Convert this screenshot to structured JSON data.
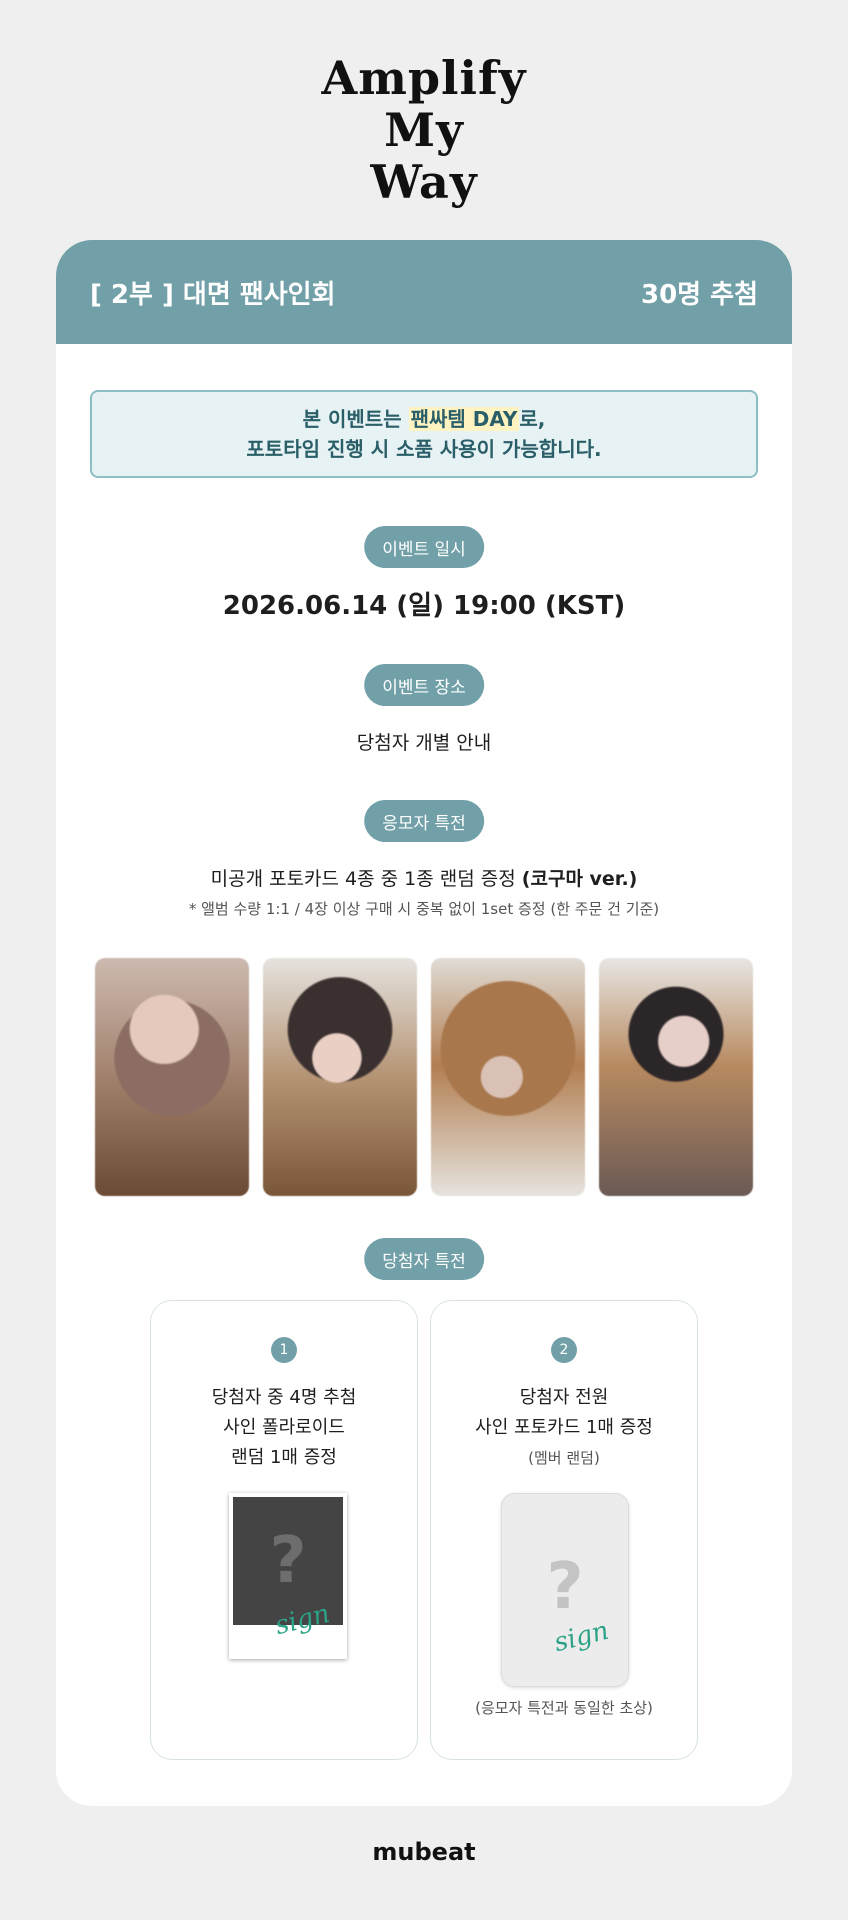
{
  "logo": {
    "lines": [
      "Amplify",
      "My",
      "Way"
    ]
  },
  "header": {
    "title": "[ 2부 ] 대면 팬사인회",
    "winners": "30명 추첨"
  },
  "notice": {
    "line1_pre": "본 이벤트는 ",
    "line1_highlight": "팬싸템 DAY",
    "line1_post": "로,",
    "line2": "포토타임 진행 시 소품 사용이 가능합니다."
  },
  "event_date": {
    "label": "이벤트 일시",
    "value": "2026.06.14 (일) 19:00 (KST)"
  },
  "event_place": {
    "label": "이벤트 장소",
    "value": "당첨자 개별 안내"
  },
  "applicant_benefit": {
    "label": "응모자 특전",
    "desc_pre": "미공개 포토카드 4종 중 1종 랜덤 증정 ",
    "desc_bold": "(코구마 ver.)",
    "note": "* 앨범 수량 1:1 / 4장 이상 구매 시 중복 없이 1set 증정 (한 주문 건 기준)"
  },
  "winner_benefit": {
    "label": "당첨자 특전",
    "items": [
      {
        "num": "1",
        "line1": "당첨자 중 4명 추첨",
        "line2": "사인 폴라로이드",
        "line3": "랜덤 1매 증정",
        "sub": ""
      },
      {
        "num": "2",
        "line1": "당첨자 전원",
        "line2": "사인 포토카드 1매 증정",
        "line3": "",
        "sub": "(멤버 랜덤)",
        "caption": "(응모자 특전과 동일한 초상)"
      }
    ],
    "sign": "sign",
    "question": "?"
  },
  "footer": {
    "brand": "mubeat"
  },
  "colors": {
    "accent": "#72a0a8",
    "background": "#efefef",
    "notice_bg": "#e6f2f3",
    "sign_green": "#2ca388"
  }
}
